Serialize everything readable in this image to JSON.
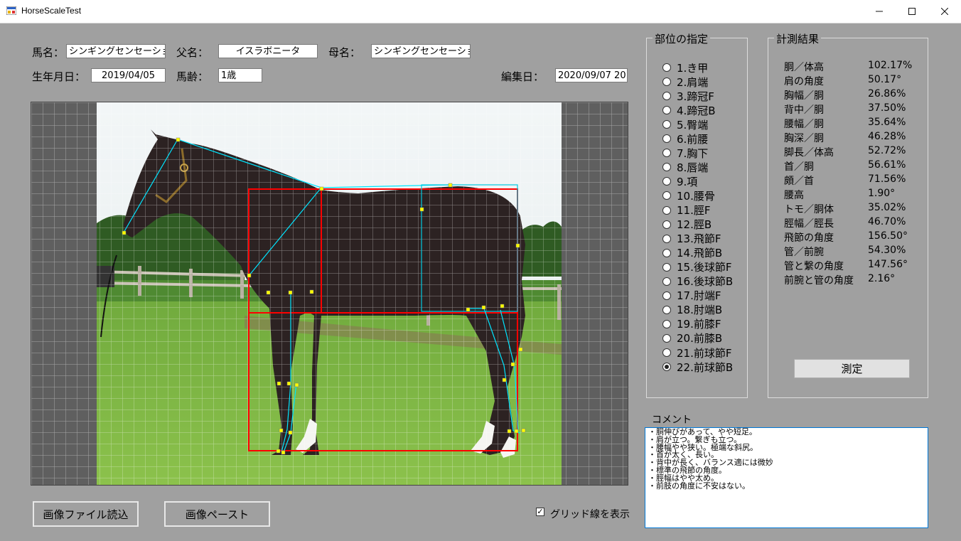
{
  "window": {
    "title": "HorseScaleTest"
  },
  "form": {
    "name_label": "馬名：",
    "name_value": "シンギングセンセーションの'",
    "sire_label": "父名：",
    "sire_value": "イスラボニータ",
    "dam_label": "母名：",
    "dam_value": "シンギングセンセーション",
    "birth_label": "生年月日：",
    "birth_value": "2019/04/05",
    "age_label": "馬齢：",
    "age_value": "1歳",
    "edit_label": "編集日：",
    "edit_value": "2020/09/07 20"
  },
  "parts": {
    "title": "部位の指定",
    "selected": "22.前球節B",
    "items": [
      "1.き甲",
      "2.肩端",
      "3.蹄冠F",
      "4.蹄冠B",
      "5.臀端",
      "6.前腰",
      "7.胸下",
      "8.唇端",
      "9.項",
      "10.腰骨",
      "11.脛F",
      "12.脛B",
      "13.飛節F",
      "14.飛節B",
      "15.後球節F",
      "16.後球節B",
      "17.肘端F",
      "18.肘端B",
      "19.前膝F",
      "20.前膝B",
      "21.前球節F",
      "22.前球節B"
    ]
  },
  "results": {
    "title": "計測結果",
    "rows": [
      {
        "k": "胴／体高",
        "v": "102.17%"
      },
      {
        "k": "肩の角度",
        "v": "50.17°"
      },
      {
        "k": "胸幅／胴",
        "v": "26.86%"
      },
      {
        "k": "背中／胴",
        "v": "37.50%"
      },
      {
        "k": "腰幅／胴",
        "v": "35.64%"
      },
      {
        "k": "胸深／胴",
        "v": "46.28%"
      },
      {
        "k": "脚長／体高",
        "v": "52.72%"
      },
      {
        "k": "首／胴",
        "v": "56.61%"
      },
      {
        "k": "頗／首",
        "v": "71.56%"
      },
      {
        "k": "腰高",
        "v": "1.90°"
      },
      {
        "k": "トモ／胴体",
        "v": "35.02%"
      },
      {
        "k": "脛幅／脛長",
        "v": "46.70%"
      },
      {
        "k": "飛節の角度",
        "v": "156.50°"
      },
      {
        "k": "管／前腕",
        "v": "54.30%"
      },
      {
        "k": "管と繋の角度",
        "v": "147.56°"
      },
      {
        "k": "前腕と管の角度",
        "v": "2.16°"
      }
    ],
    "measure_button": "測定"
  },
  "comment": {
    "label": "コメント",
    "lines": [
      "・胴伸びがあって、やや短足。",
      "・肩が立つ。繋ぎも立つ。",
      "・腰幅やや狭い。極端な斜尻。",
      "・首が太く、長い。",
      "・背中が長く、バランス適には微妙",
      "・標準の飛節の角度。",
      "・脛幅はやや太め。",
      "・前肢の角度に不安はない。"
    ]
  },
  "bottom": {
    "load_button": "画像ファイル読込",
    "paste_button": "画像ペースト",
    "grid_checkbox": "グリッド線を表示",
    "grid_checked": true
  },
  "colors": {
    "overlay_red": "#ff0000",
    "overlay_cyan": "#00e5ff",
    "marker": "#ffff00"
  }
}
